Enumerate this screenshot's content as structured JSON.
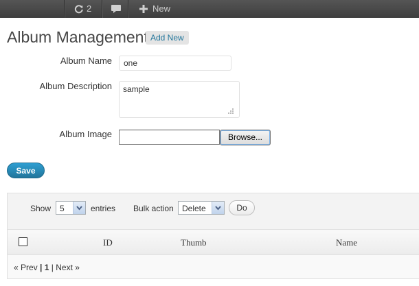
{
  "adminbar": {
    "updates_count": "2",
    "new_label": "New",
    "icons": [
      "refresh-icon",
      "comment-icon",
      "plus-icon"
    ]
  },
  "header": {
    "title": "Album Management",
    "add_new_label": "Add New"
  },
  "form": {
    "album_name_label": "Album Name",
    "album_name_value": "one",
    "album_description_label": "Album Description",
    "album_description_value": "sample",
    "album_image_label": "Album Image",
    "browse_label": "Browse...",
    "save_label": "Save"
  },
  "table_controls": {
    "show_label": "Show",
    "entries_value": "5",
    "entries_label": "entries",
    "bulk_action_label": "Bulk action",
    "bulk_action_value": "Delete",
    "do_label": "Do"
  },
  "table": {
    "columns": [
      "ID",
      "Thumb",
      "Name"
    ]
  },
  "pagination": {
    "prev": "« Prev",
    "sep1": "|",
    "current": "1",
    "sep2": "|",
    "next": "Next »"
  },
  "colors": {
    "adminbar": "#464646",
    "link": "#21759b",
    "save_button": "#21759b"
  }
}
